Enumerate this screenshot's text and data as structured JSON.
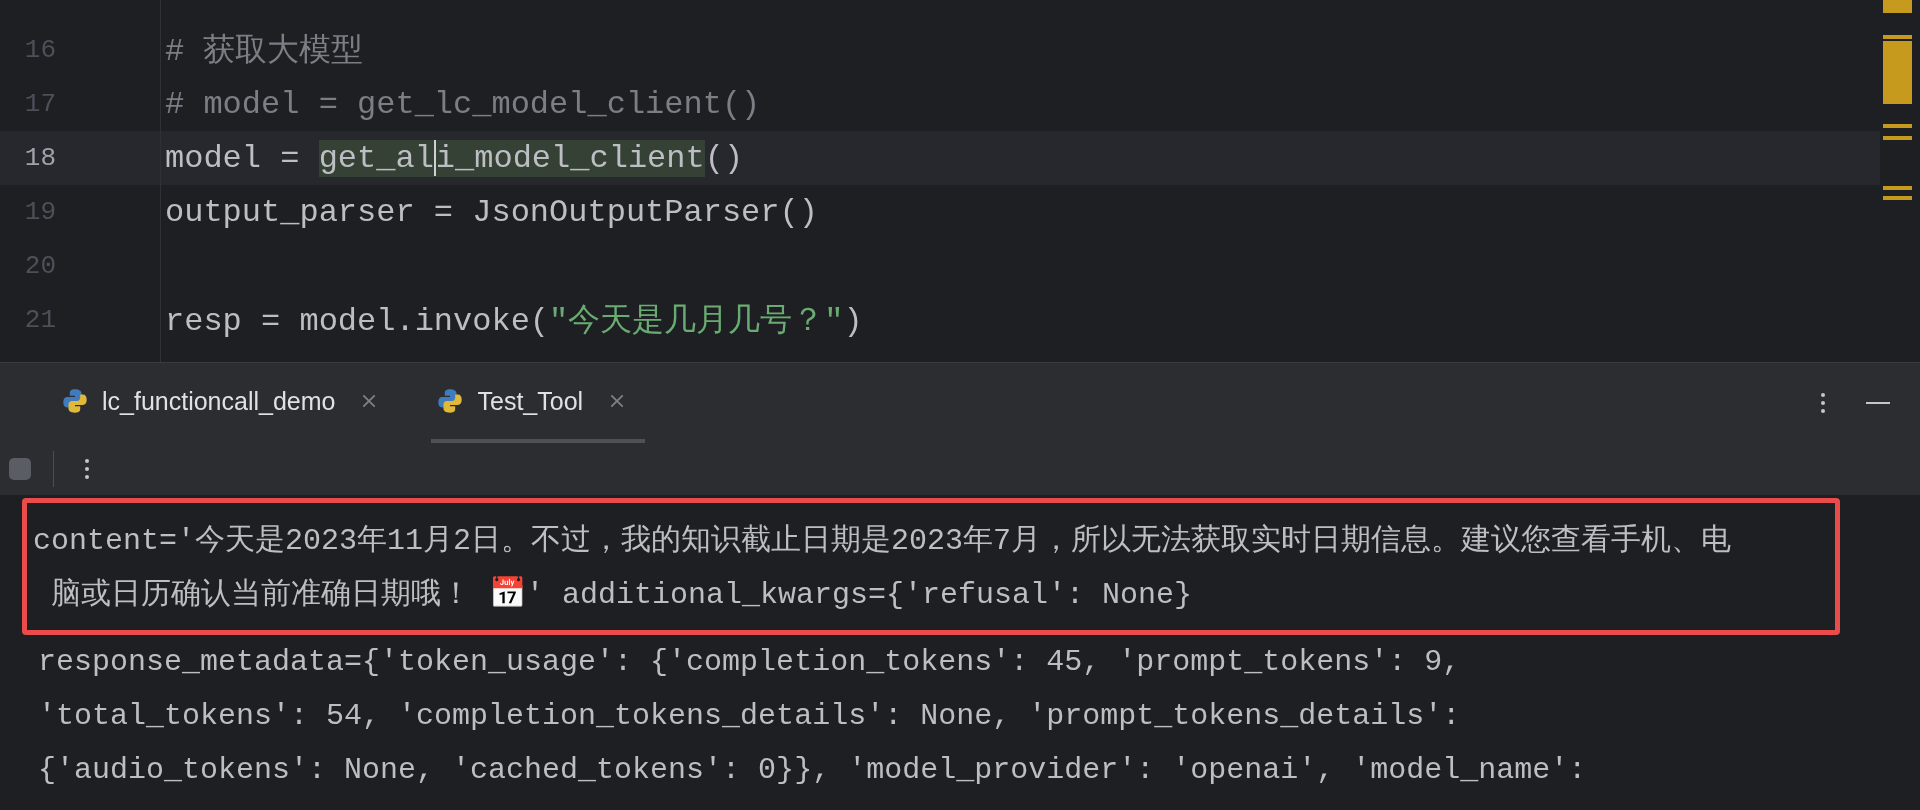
{
  "editor": {
    "lines": [
      {
        "number": "16",
        "current": false,
        "segments": [
          {
            "text": "# 获取大模型",
            "kind": "comment"
          }
        ]
      },
      {
        "number": "17",
        "current": false,
        "segments": [
          {
            "text": "# model = get_lc_model_client()",
            "kind": "comment"
          }
        ]
      },
      {
        "number": "18",
        "current": true,
        "segments": [
          {
            "text": "model = ",
            "kind": "code"
          },
          {
            "text": "get_al",
            "kind": "match"
          },
          {
            "text": "i_model_client",
            "kind": "match",
            "caret_before": true
          },
          {
            "text": "()",
            "kind": "code"
          }
        ]
      },
      {
        "number": "19",
        "current": false,
        "segments": [
          {
            "text": "output_parser = JsonOutputParser()",
            "kind": "code"
          }
        ]
      },
      {
        "number": "20",
        "current": false
      },
      {
        "number": "21",
        "current": false,
        "segments": [
          {
            "text": "resp = model.invoke(",
            "kind": "code"
          },
          {
            "text": "\"今天是几月几号？\"",
            "kind": "string"
          },
          {
            "text": ")",
            "kind": "code"
          }
        ]
      }
    ]
  },
  "tool_window": {
    "tabs": [
      {
        "label": "lc_functioncall_demo",
        "selected": false
      },
      {
        "label": "Test_Tool",
        "selected": true
      }
    ]
  },
  "console": {
    "boxed_lines": [
      "content='今天是2023年11月2日。不过，我的知识截止日期是2023年7月，所以无法获取实时日期信息。建议您查看手机、电",
      " 脑或日历确认当前准确日期哦！ 📅' additional_kwargs={'refusal': None}"
    ],
    "lines": [
      " response_metadata={'token_usage': {'completion_tokens': 45, 'prompt_tokens': 9,",
      " 'total_tokens': 54, 'completion_tokens_details': None, 'prompt_tokens_details':",
      " {'audio_tokens': None, 'cached_tokens': 0}}, 'model_provider': 'openai', 'model_name':"
    ]
  }
}
